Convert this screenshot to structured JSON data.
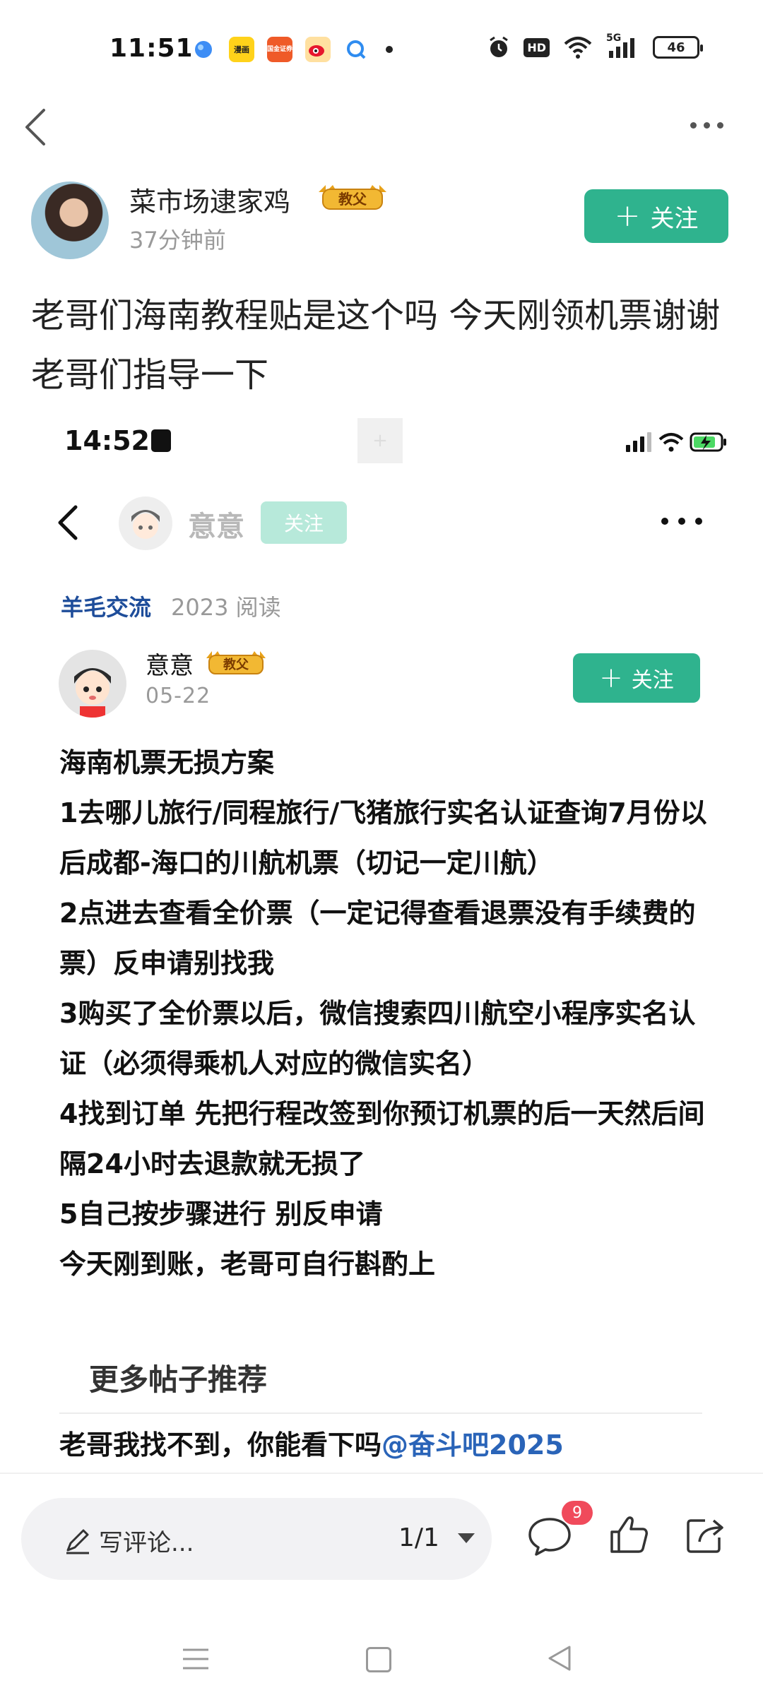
{
  "status_bar": {
    "time": "11:51",
    "app_icons": [
      "bubble-app-icon",
      "cartoon-app-icon",
      "securities-app-icon",
      "weibo-icon",
      "search-app-icon"
    ],
    "app_icon_labels": {
      "cartoon": "漫画",
      "securities": "国金证券"
    },
    "hd_label": "HD",
    "network_label": "5G",
    "battery": "46"
  },
  "author": {
    "name": "菜市场逮家鸡",
    "badge": "教父",
    "time": "37分钟前",
    "follow_label": "关注"
  },
  "post_title": "老哥们海南教程贴是这个吗 今天刚领机票谢谢老哥们指导一下",
  "embedded": {
    "time": "14:52",
    "top_name": "意意",
    "top_follow_label": "关注",
    "category": "羊毛交流",
    "reads": "2023 阅读",
    "author_name": "意意",
    "author_badge": "教父",
    "date": "05-22",
    "follow_label": "关注",
    "body": [
      "海南机票无损方案",
      "1去哪儿旅行/同程旅行/飞猪旅行实名认证查询7月份以后成都-海口的川航机票（切记一定川航）",
      "2点进去查看全价票（一定记得查看退票没有手续费的票）反申请别找我",
      "3购买了全价票以后，微信搜索四川航空小程序实名认证（必须得乘机人对应的微信实名）",
      "4找到订单 先把行程改签到你预订机票的后一天然后间隔24小时去退款就无损了",
      "5自己按步骤进行 别反申请",
      "今天刚到账，老哥可自行斟酌上"
    ],
    "more_posts_title": "更多帖子推荐",
    "comment_text": "老哥我找不到，你能看下吗",
    "comment_mention": "@奋斗吧2025"
  },
  "bottom_bar": {
    "comment_placeholder": "写评论...",
    "page_indicator": "1/1",
    "comment_count": "9"
  },
  "colors": {
    "accent_green": "#2fb38e",
    "link_blue": "#1e4d9a",
    "badge_red": "#f04a5b",
    "badge_gold": "#e8a21a"
  }
}
